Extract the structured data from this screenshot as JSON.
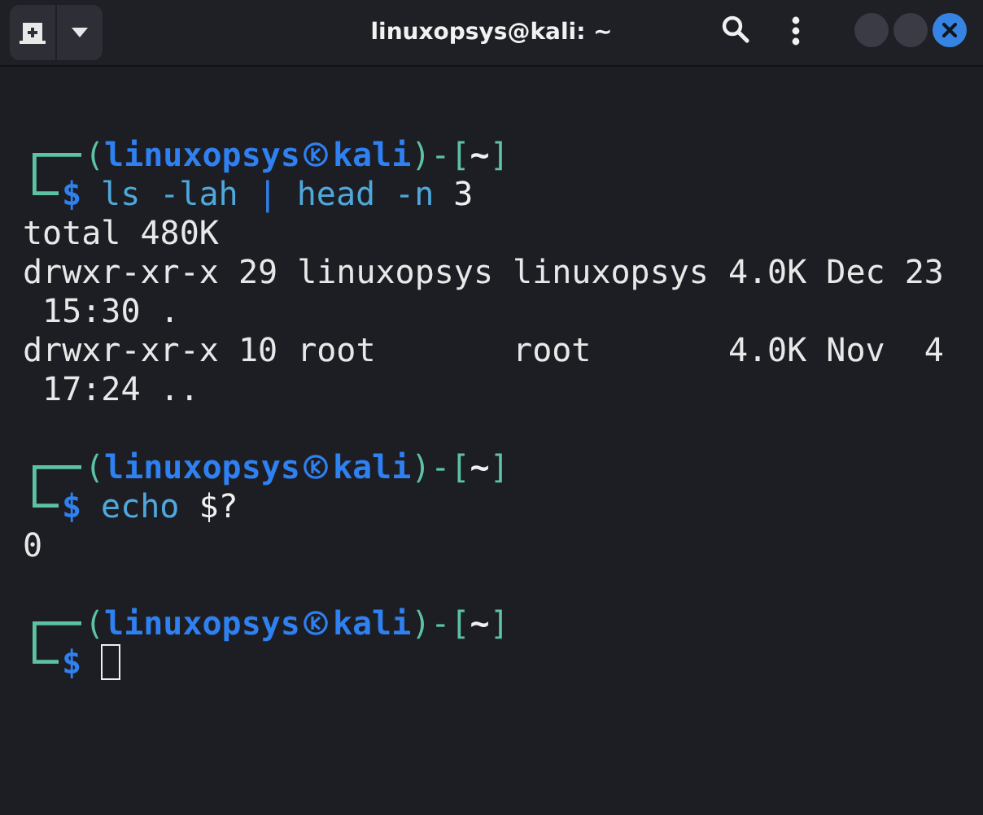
{
  "window": {
    "title": "linuxopsys@kali: ~"
  },
  "terminal": {
    "blocks": [
      {
        "prompt": [
          {
            "kind": "punct",
            "text": "("
          },
          {
            "kind": "user",
            "text": "linuxopsys"
          },
          {
            "kind": "mark"
          },
          {
            "kind": "user",
            "text": "kali"
          },
          {
            "kind": "punct",
            "text": ")-["
          },
          {
            "kind": "dir",
            "text": "~"
          },
          {
            "kind": "punct",
            "text": "]"
          }
        ],
        "sigil": "$",
        "command": [
          {
            "kind": "program",
            "text": "ls"
          },
          {
            "kind": "option",
            "text": "-lah"
          },
          {
            "kind": "pipe",
            "text": "|"
          },
          {
            "kind": "program",
            "text": "head"
          },
          {
            "kind": "option",
            "text": "-n"
          },
          {
            "kind": "literal",
            "text": "3"
          }
        ],
        "output": [
          "total 480K",
          "drwxr-xr-x 29 linuxopsys linuxopsys 4.0K Dec 23",
          " 15:30 .",
          "drwxr-xr-x 10 root       root       4.0K Nov  4",
          " 17:24 .."
        ]
      },
      {
        "prompt": [
          {
            "kind": "punct",
            "text": "("
          },
          {
            "kind": "user",
            "text": "linuxopsys"
          },
          {
            "kind": "mark"
          },
          {
            "kind": "user",
            "text": "kali"
          },
          {
            "kind": "punct",
            "text": ")-["
          },
          {
            "kind": "dir",
            "text": "~"
          },
          {
            "kind": "punct",
            "text": "]"
          }
        ],
        "sigil": "$",
        "command": [
          {
            "kind": "program",
            "text": "echo"
          },
          {
            "kind": "literal",
            "text": "$?"
          }
        ],
        "output": [
          "0"
        ]
      },
      {
        "prompt": [
          {
            "kind": "punct",
            "text": "("
          },
          {
            "kind": "user",
            "text": "linuxopsys"
          },
          {
            "kind": "mark"
          },
          {
            "kind": "user",
            "text": "kali"
          },
          {
            "kind": "punct",
            "text": ")-["
          },
          {
            "kind": "dir",
            "text": "~"
          },
          {
            "kind": "punct",
            "text": "]"
          }
        ],
        "sigil": "$",
        "cursor": true
      }
    ]
  }
}
